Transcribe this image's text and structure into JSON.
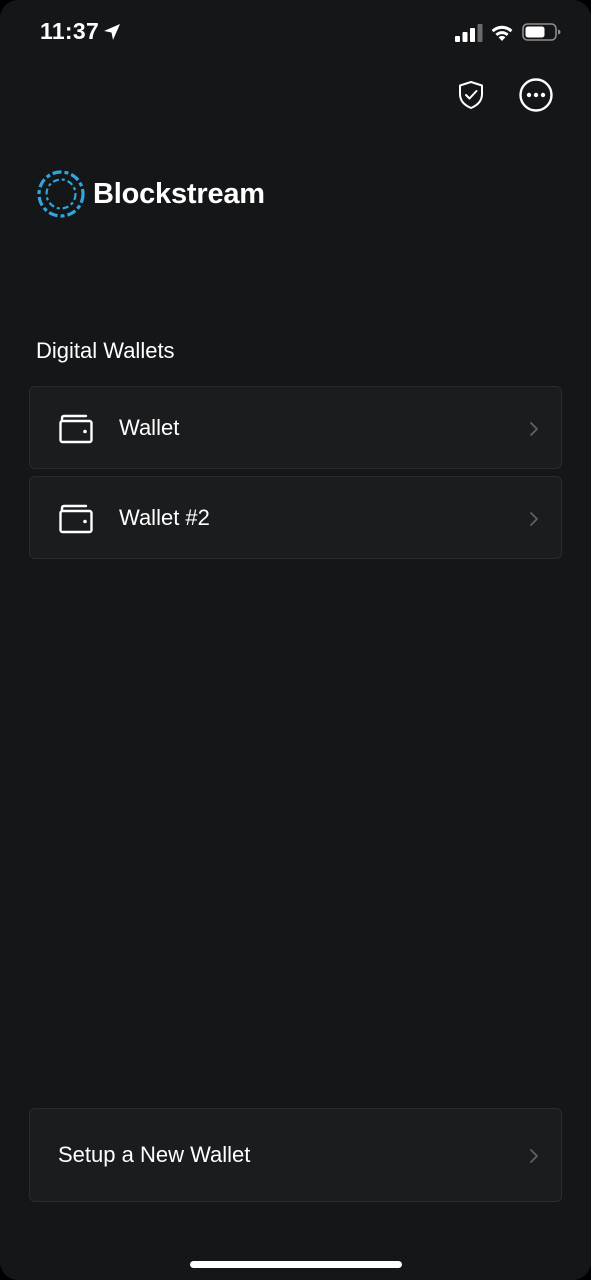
{
  "status_bar": {
    "time": "11:37",
    "icons": [
      "location-arrow-icon",
      "cellular-signal-icon",
      "wifi-icon",
      "battery-icon"
    ]
  },
  "header": {
    "icons": [
      "shield-check-icon",
      "more-options-icon"
    ]
  },
  "brand": {
    "name": "Blockstream",
    "logo_color": "#2ea7e0"
  },
  "wallets_section": {
    "title": "Digital Wallets",
    "items": [
      {
        "label": "Wallet",
        "icon": "wallet-icon"
      },
      {
        "label": "Wallet #2",
        "icon": "wallet-icon"
      }
    ]
  },
  "setup": {
    "label": "Setup a New Wallet"
  },
  "colors": {
    "background": "#151618",
    "card": "#1b1c1e",
    "card_border": "#2a2b2e",
    "text": "#ffffff",
    "chevron": "#5f6166",
    "accent": "#2ea7e0"
  }
}
